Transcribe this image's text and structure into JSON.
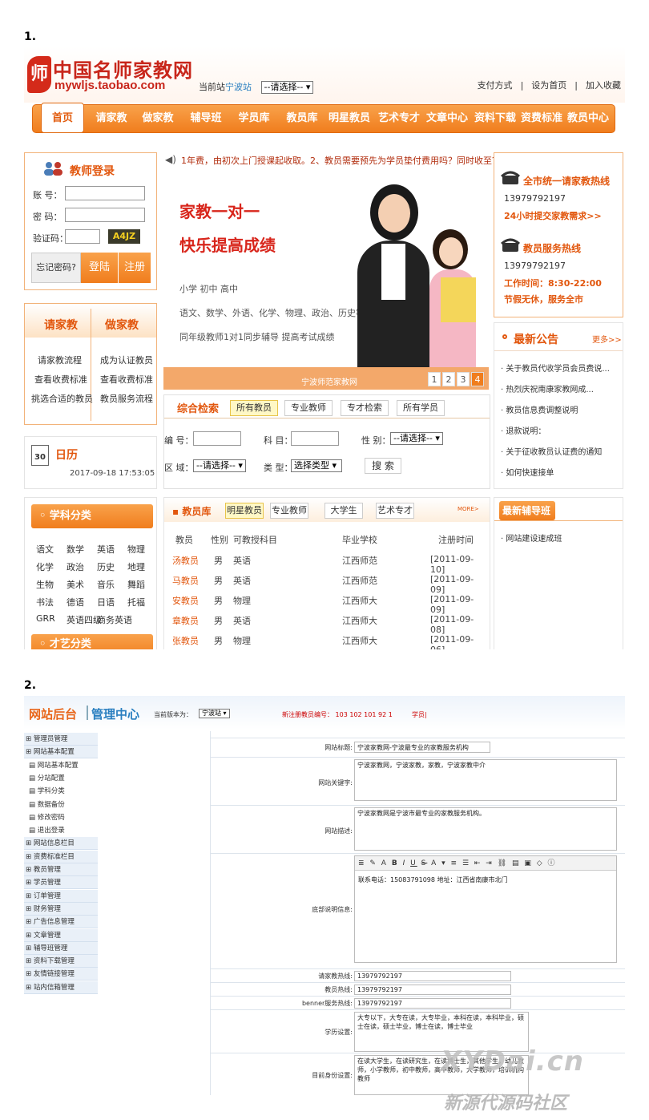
{
  "sections": {
    "s1": "1.",
    "s2": "2."
  },
  "shot1": {
    "logo": {
      "glyph": "师",
      "name": "中国名师家教网",
      "url": "mywljs.taobao.com"
    },
    "site": {
      "label": "当前站",
      "city": "宁波站",
      "select": "--请选择--"
    },
    "toplinks": [
      "支付方式",
      "|",
      "设为首页",
      "|",
      "加入收藏"
    ],
    "nav": [
      "首页",
      "请家教",
      "做家教",
      "辅导班",
      "学员库",
      "教员库",
      "明星教员",
      "艺术专才",
      "文章中心",
      "资料下载",
      "资费标准",
      "教员中心"
    ],
    "login": {
      "title": "教师登录",
      "account": "账 号：",
      "password": "密 码：",
      "captcha": "验证码：",
      "captcha_img": "A4JZ",
      "forgot": "忘记密码?",
      "login": "登陆",
      "register": "注册"
    },
    "hire": {
      "left_title": "请家教",
      "right_title": "做家教",
      "left_items": [
        "请家教流程",
        "查看收费标准",
        "挑选合适的教员"
      ],
      "right_items": [
        "成为认证教员",
        "查看收费标准",
        "教员服务流程"
      ]
    },
    "calendar": {
      "title": "日历",
      "icon_day": "30",
      "datetime": "2017-09-18 17:53:05"
    },
    "notice": "1年费，由初次上门授课起收取。2、教员需要预先为学员垫付费用吗？同时收至？",
    "banner": {
      "h1": "家教一对一",
      "h2": "快乐提高成绩",
      "levels": "小学  初中  高中",
      "subjects": "语文、数学、外语、化学、物理、政治、历史等",
      "slogan": "同年级教师1对1同步辅导 提高考试成绩",
      "caption": "宁波师范家教网",
      "pages": [
        "1",
        "2",
        "3",
        "4"
      ]
    },
    "search": {
      "title": "综合检索",
      "tabs": [
        "所有教员",
        "专业教师",
        "专才检索",
        "所有学员"
      ],
      "no_label": "编 号：",
      "subject_label": "科 目：",
      "gender_label": "性 别：",
      "gender_select": "--请选择--",
      "area_label": "区 域：",
      "area_select": "--请选择--",
      "type_label": "类 型：",
      "type_select": "选择类型",
      "button": "搜 索"
    },
    "hotline": {
      "title1": "全市统一请家教热线",
      "phone1": "13979792197",
      "tagline1": "24小时提交家教需求>>",
      "title2": "教员服务热线",
      "phone2": "13979792197",
      "hours": "工作时间：8:30-22:00",
      "tagline2": "节假无休，服务全市"
    },
    "announce": {
      "title": "最新公告",
      "more": "更多>>",
      "items": [
        "关于教员代收学员会员费说...",
        "热烈庆祝南康家教网成...",
        "教员信息费调整说明",
        "退款说明：",
        "关于征收教员认证费的通知",
        "如何快速接单"
      ]
    },
    "category": {
      "title": "学科分类",
      "rows": [
        [
          "语文",
          "数学",
          "英语",
          "物理"
        ],
        [
          "化学",
          "政治",
          "历史",
          "地理"
        ],
        [
          "生物",
          "美术",
          "音乐",
          "舞蹈"
        ],
        [
          "书法",
          "德语",
          "日语",
          "托福"
        ],
        [
          "GRR",
          "英语四级",
          "商务英语",
          ""
        ]
      ],
      "next": "才艺分类"
    },
    "teachers": {
      "title": "教员库",
      "tabs": [
        "明星教员",
        "专业教师",
        "大学生",
        "艺术专才"
      ],
      "more": "MORE>",
      "headers": [
        "教员",
        "性别",
        "可教授科目",
        "毕业学校",
        "注册时间"
      ],
      "rows": [
        [
          "汤教员",
          "男",
          "英语",
          "江西师范",
          "[2011-09-10]"
        ],
        [
          "马教员",
          "男",
          "英语",
          "江西师范",
          "[2011-09-09]"
        ],
        [
          "安教员",
          "男",
          "物理",
          "江西师大",
          "[2011-09-09]"
        ],
        [
          "章教员",
          "男",
          "英语",
          "江西师大",
          "[2011-09-08]"
        ],
        [
          "张教员",
          "男",
          "物理",
          "江西师大",
          "[2011-09-06]"
        ]
      ]
    },
    "tutoring": {
      "title": "最新辅导班",
      "items": [
        "网站建设速成班"
      ]
    }
  },
  "shot2": {
    "title_a": "网站后台",
    "title_b": "管理中心",
    "branch_label": "当前版本为：",
    "branch_value": "宁波站",
    "new_teacher": "新注册教员编号：  103  102  101  92  1",
    "student": "学员|",
    "sidebar": [
      {
        "t": "管理员管理",
        "k": "grp"
      },
      {
        "t": "网站基本配置",
        "k": "grp"
      },
      {
        "t": "网站基本配置",
        "k": "sub"
      },
      {
        "t": "分站配置",
        "k": "sub"
      },
      {
        "t": "学科分类",
        "k": "sub"
      },
      {
        "t": "数据备份",
        "k": "sub"
      },
      {
        "t": "修改密码",
        "k": "sub"
      },
      {
        "t": "退出登录",
        "k": "sub"
      },
      {
        "t": "网站信息栏目",
        "k": "grp"
      },
      {
        "t": "资费标准栏目",
        "k": "grp"
      },
      {
        "t": "教员管理",
        "k": "grp"
      },
      {
        "t": "学员管理",
        "k": "grp"
      },
      {
        "t": "订单管理",
        "k": "grp"
      },
      {
        "t": "财务管理",
        "k": "grp"
      },
      {
        "t": "广告信息管理",
        "k": "grp"
      },
      {
        "t": "文章管理",
        "k": "grp"
      },
      {
        "t": "辅导班管理",
        "k": "grp"
      },
      {
        "t": "资料下载管理",
        "k": "grp"
      },
      {
        "t": "友情链接管理",
        "k": "grp"
      },
      {
        "t": "站内信箱管理",
        "k": "grp"
      }
    ],
    "form": {
      "site_title_label": "网站标题:",
      "site_title": "宁波家教网-宁波最专业的家教服务机构",
      "keywords_label": "网站关键字:",
      "keywords": "宁波家教网，宁波家教，家教，宁波家教中介",
      "desc_label": "网站描述:",
      "desc": "宁波家教网是宁波市最专业的家教服务机构。",
      "footer_label": "底部说明信息:",
      "footer": "联系电话：15083791098     地址：江西省南康市北门",
      "hotline_label": "请家教热线:",
      "hotline": "13979792197",
      "teacher_line_label": "教员热线:",
      "teacher_line": "13979792197",
      "banner_line_label": "benner服务热线:",
      "banner_line": "13979792197",
      "edu_label": "学历设置:",
      "edu": "大专以下，大专在读，大专毕业，本科在读，本科毕业，硕士在读，硕士毕业，博士在读，博士毕业",
      "identity_label": "目前身份设置:",
      "identity": "在读大学生，在读研究生，在读博士生，其他学生，幼儿教师，小学教师，初中教师，高中教师，大学教师，培训机构教师"
    },
    "watermark": {
      "brand": "XYDai.cn",
      "sub": "新源代源码社区"
    }
  },
  "colors": {
    "orange": "#f07d1d",
    "red": "#d42a1a",
    "blue": "#2a7fc0"
  }
}
